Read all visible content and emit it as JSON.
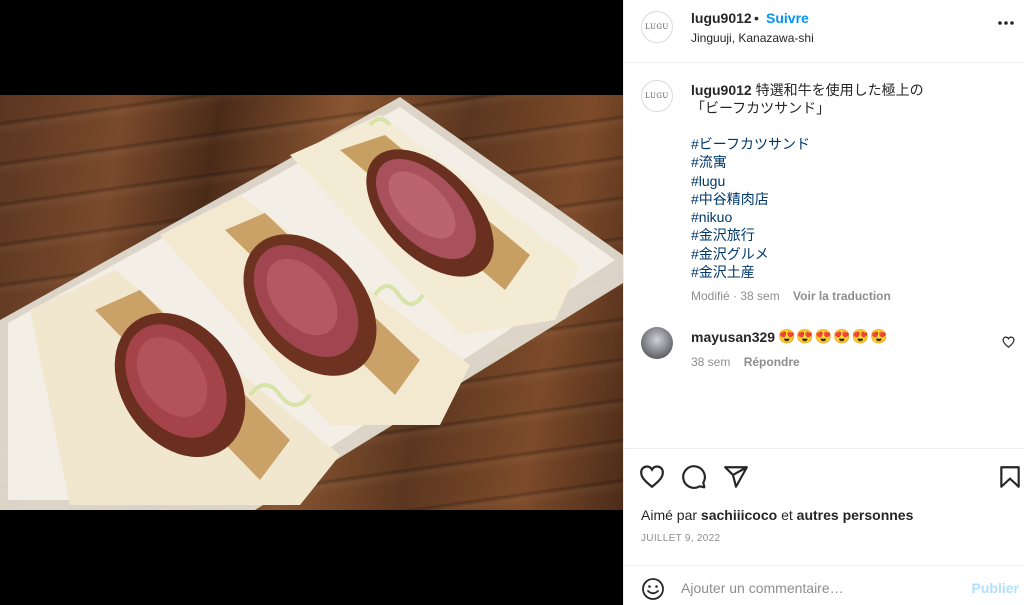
{
  "post": {
    "username": "lugu9012",
    "dot": "•",
    "follow_label": "Suivre",
    "location": "Jinguuji, Kanazawa-shi",
    "avatar_logo": "LUGU"
  },
  "caption": {
    "username": "lugu9012",
    "line1": "特選和牛を使用した極上の",
    "line2": "「ビーフカツサンド」",
    "hashtags": [
      "#ビーフカツサンド",
      "#流寓",
      "#lugu",
      "#中谷精肉店",
      "#nikuo",
      "#金沢旅行",
      "#金沢グルメ",
      "#金沢土産"
    ],
    "edited": "Modifié · 38 sem",
    "translate": "Voir la traduction"
  },
  "comment": {
    "username": "mayusan329",
    "emojis": "😍😍😍😍😍😍",
    "time": "38 sem",
    "reply": "Répondre"
  },
  "actions": {
    "icons": [
      "heart-icon",
      "comment-icon",
      "share-icon",
      "bookmark-icon"
    ]
  },
  "likes": {
    "prefix": "Aimé par",
    "user": "sachiiicoco",
    "joiner": "et",
    "others": "autres personnes"
  },
  "date": "JUILLET 9, 2022",
  "add_comment": {
    "placeholder": "Ajouter un commentaire…",
    "publish_label": "Publier"
  },
  "colors": {
    "link": "#0095f6",
    "hashtag": "#00376b",
    "muted": "#8e8e8e",
    "publish_disabled": "#b2dffc"
  }
}
